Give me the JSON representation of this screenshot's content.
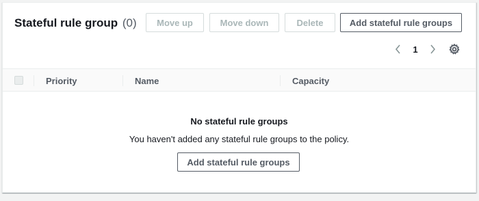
{
  "header": {
    "title": "Stateful rule group",
    "count": "(0)"
  },
  "toolbar": {
    "move_up_label": "Move up",
    "move_down_label": "Move down",
    "delete_label": "Delete",
    "add_label": "Add stateful rule groups"
  },
  "pagination": {
    "current_page": "1"
  },
  "table": {
    "columns": [
      "Priority",
      "Name",
      "Capacity"
    ]
  },
  "empty_state": {
    "title": "No stateful rule groups",
    "description": "You haven't added any stateful rule groups to the policy.",
    "button_label": "Add stateful rule groups"
  },
  "icons": {
    "prev": "chevron-left-icon",
    "next": "chevron-right-icon",
    "settings": "gear-icon"
  }
}
